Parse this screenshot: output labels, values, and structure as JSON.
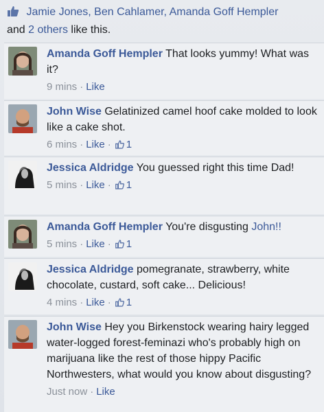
{
  "likes": {
    "names": "Jamie Jones, Ben Cahlamer, Amanda Goff Hempler",
    "and_text": "and",
    "others_link": "2 others",
    "suffix": "like this."
  },
  "comments": [
    {
      "author": "Amanda Goff Hempler",
      "text": "That looks yummy! What was it?",
      "time": "9 mins",
      "like_label": "Like",
      "like_count": ""
    },
    {
      "author": "John Wise",
      "text": "Gelatinized camel hoof cake molded to look like a cake shot.",
      "time": "6 mins",
      "like_label": "Like",
      "like_count": "1"
    },
    {
      "author": "Jessica Aldridge",
      "text": "You guessed right this time Dad!",
      "time": "5 mins",
      "like_label": "Like",
      "like_count": "1"
    },
    {
      "author": "Amanda Goff Hempler",
      "text": "You're disgusting",
      "mention": "John!!",
      "time": "5 mins",
      "like_label": "Like",
      "like_count": "1"
    },
    {
      "author": "Jessica Aldridge",
      "text": "pomegranate, strawberry, white chocolate, custard, soft cake... Delicious!",
      "time": "4 mins",
      "like_label": "Like",
      "like_count": "1"
    },
    {
      "author": "John Wise",
      "text": "Hey you Birkenstock wearing hairy legged water-logged forest-feminazi who's probably high on marijuana like the rest of those hippy Pacific Northwesters, what would you know about disgusting?",
      "time": "Just now",
      "like_label": "Like",
      "like_count": ""
    }
  ],
  "colors": {
    "link": "#3b5998",
    "meta": "#8a9099",
    "background": "#dfe3e8"
  },
  "icons": {
    "like": "thumbs-up-icon"
  }
}
